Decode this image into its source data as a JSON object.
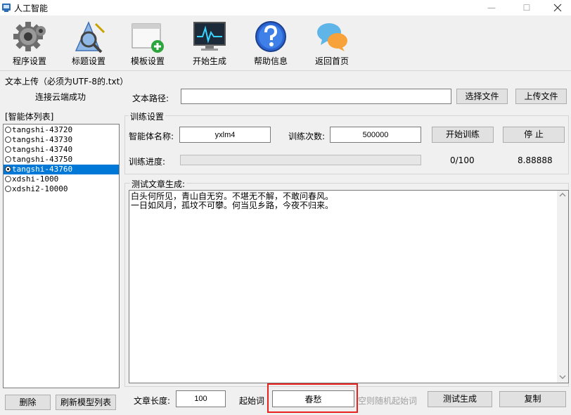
{
  "window": {
    "title": "人工智能",
    "controls": {
      "minimize": "—",
      "maximize": "☐"
    }
  },
  "toolbar": {
    "items": [
      {
        "label": "程序设置",
        "icon": "gear-icon"
      },
      {
        "label": "标题设置",
        "icon": "wizard-icon"
      },
      {
        "label": "模板设置",
        "icon": "window-add-icon"
      },
      {
        "label": "开始生成",
        "icon": "monitor-chart-icon"
      },
      {
        "label": "帮助信息",
        "icon": "help-icon"
      },
      {
        "label": "返回首页",
        "icon": "chat-icon"
      }
    ]
  },
  "upload": {
    "section_label": "文本上传（必须为UTF-8的.txt）",
    "status": "连接云端成功",
    "path_label": "文本路径:",
    "path_value": "",
    "select_button": "选择文件",
    "upload_button": "上传文件"
  },
  "agents": {
    "title": "[智能体列表]",
    "items": [
      {
        "name": "tangshi-43720",
        "selected": false
      },
      {
        "name": "tangshi-43730",
        "selected": false
      },
      {
        "name": "tangshi-43740",
        "selected": false
      },
      {
        "name": "tangshi-43750",
        "selected": false
      },
      {
        "name": "tangshi-43760",
        "selected": true
      },
      {
        "name": "xdshi-1000",
        "selected": false
      },
      {
        "name": "xdshi2-10000",
        "selected": false
      }
    ],
    "delete_button": "删除",
    "refresh_button": "刷新模型列表"
  },
  "training": {
    "title": "训练设置",
    "name_label": "智能体名称:",
    "name_value": "yxlm4",
    "count_label": "训练次数:",
    "count_value": "500000",
    "start_button": "开始训练",
    "stop_button": "停 止",
    "progress_label": "训练进度:",
    "progress_fraction": 0,
    "progress_text": "0/100",
    "loss_value": "8.88888"
  },
  "test": {
    "title": "测试文章生成:",
    "output_lines": [
      "白头何所见，青山自无穷。不堪无不解，不敢问春风。",
      "一日如风月，孤坟不可攀。何当见乡路，今夜不归来。"
    ],
    "length_label": "文章长度:",
    "length_value": "100",
    "start_word_label": "起始词",
    "start_word_value": "春愁",
    "start_word_hint": "空则随机起始词",
    "generate_button": "测试生成",
    "copy_button": "复制"
  },
  "colors": {
    "selection": "#0078d7",
    "highlight_box": "#e8221d"
  }
}
